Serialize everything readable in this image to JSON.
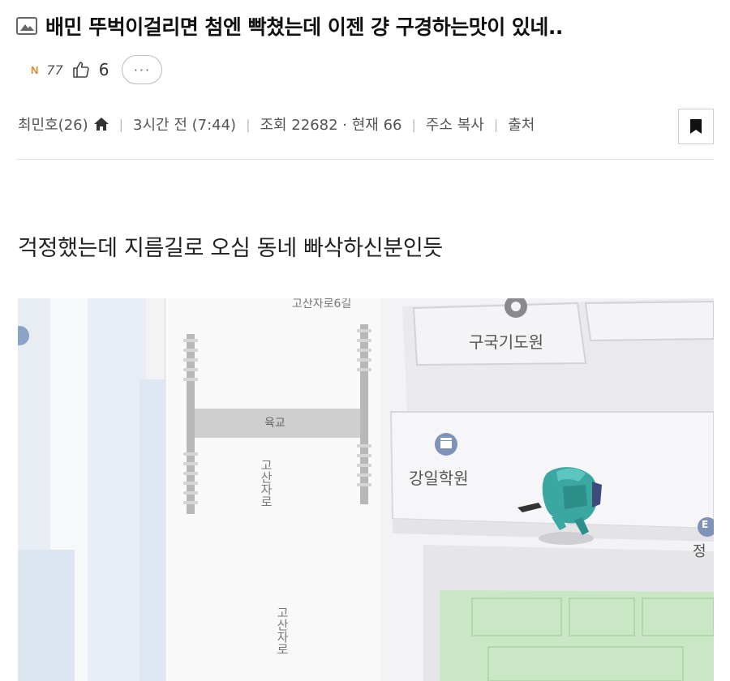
{
  "post": {
    "title": "배민 뚜벅이걸리면 첨엔 빡쳤는데 이젠 걍 구경하는맛이 있네..",
    "badge": "N",
    "stat_count": "77",
    "like_count": "6",
    "more_label": "···"
  },
  "meta": {
    "author": "최민호(26)",
    "time": "3시간 전 (7:44)",
    "views": "조회 22682 · 현재 66",
    "copy_address": "주소 복사",
    "source": "출처"
  },
  "body": {
    "text": "걱정했는데 지름길로 오심 동네 빠삭하신분인듯"
  },
  "map": {
    "road_top": "고산자로6길",
    "building_1": "구국기도원",
    "bridge": "육교",
    "building_2": "강일학원",
    "road_vertical_1": "고산자로",
    "road_vertical_2": "고산자로",
    "edge_label": "정",
    "edge_icon_glyph": "E",
    "courier_color": "#3aa7a0"
  }
}
